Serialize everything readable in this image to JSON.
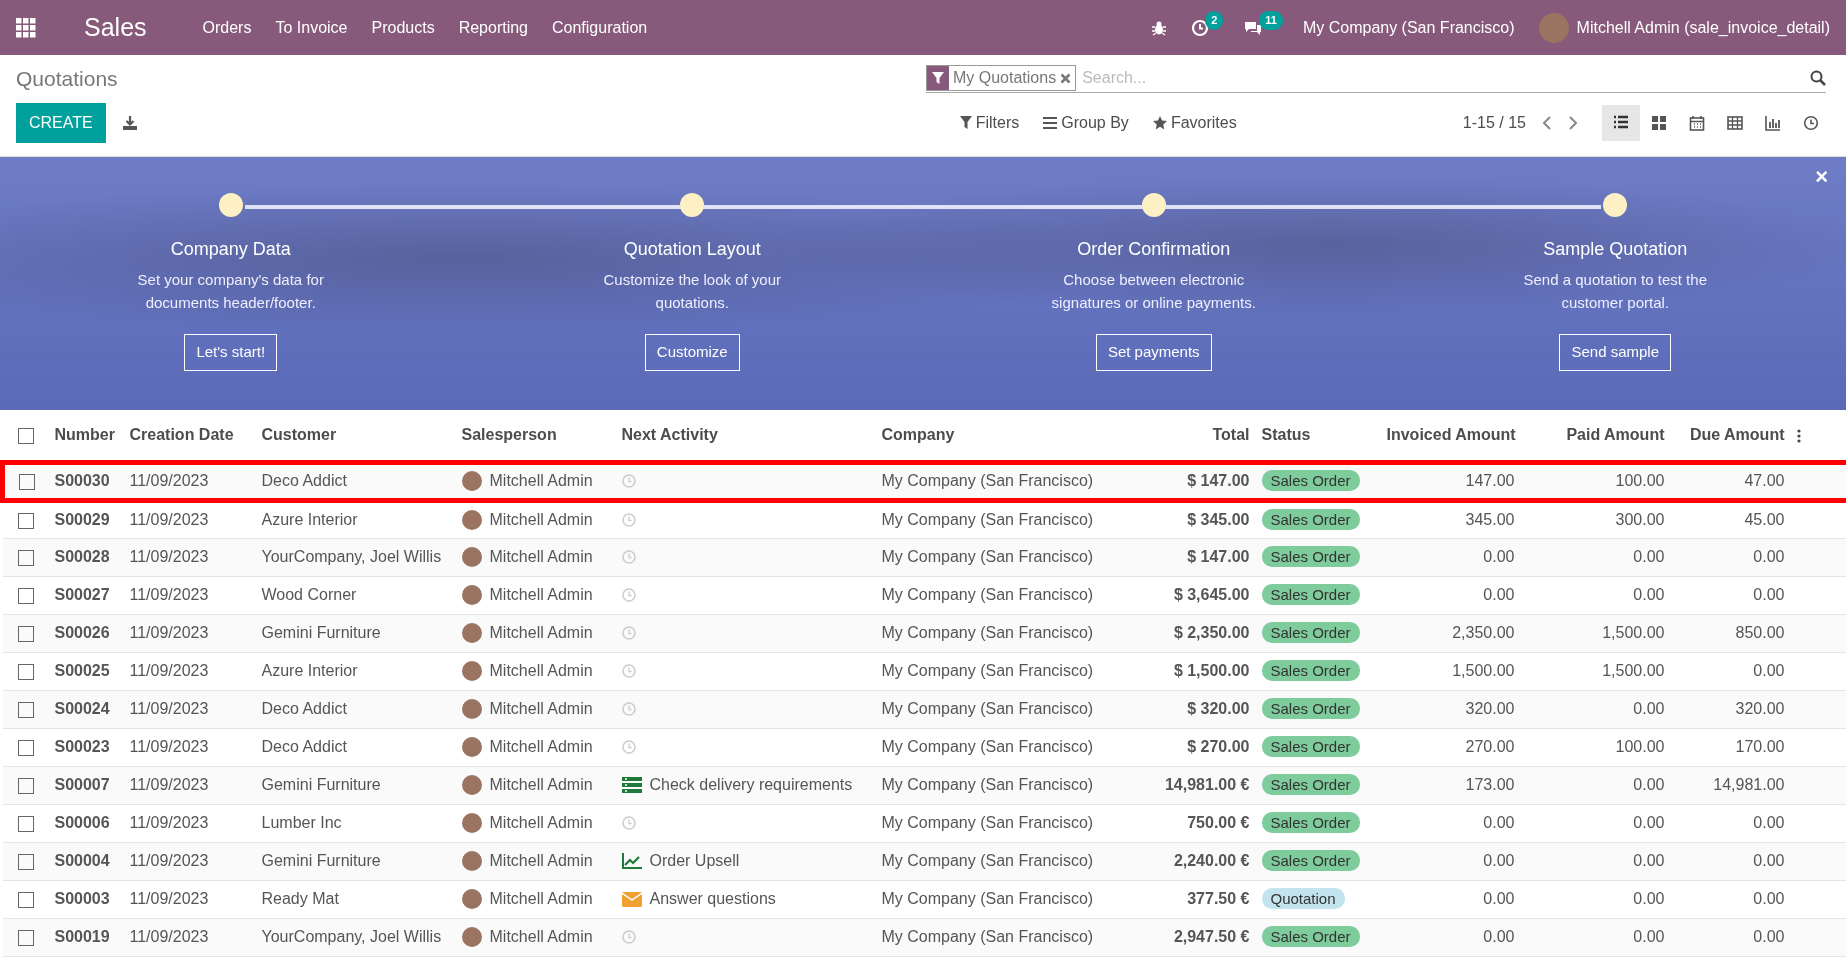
{
  "navbar": {
    "app_title": "Sales",
    "menu": [
      "Orders",
      "To Invoice",
      "Products",
      "Reporting",
      "Configuration"
    ],
    "activity_count": "2",
    "message_count": "11",
    "company": "My Company (San Francisco)",
    "user": "Mitchell Admin (sale_invoice_detail)"
  },
  "control_panel": {
    "breadcrumb": "Quotations",
    "create_label": "CREATE",
    "facet": "My Quotations",
    "search": {
      "placeholder": "Search..."
    },
    "filters": "Filters",
    "group_by": "Group By",
    "favorites": "Favorites",
    "pager": "1-15 / 15",
    "views": [
      {
        "kind": "list",
        "selected": true
      },
      {
        "kind": "kanban",
        "selected": false
      },
      {
        "kind": "calendar",
        "selected": false
      },
      {
        "kind": "pivot",
        "selected": false
      },
      {
        "kind": "graph",
        "selected": false
      },
      {
        "kind": "activity",
        "selected": false
      }
    ]
  },
  "onboarding": {
    "close": "×",
    "steps": [
      {
        "title": "Company Data",
        "text": "Set your company's data for documents header/footer.",
        "button": "Let's start!"
      },
      {
        "title": "Quotation Layout",
        "text": "Customize the look of your quotations.",
        "button": "Customize"
      },
      {
        "title": "Order Confirmation",
        "text": "Choose between electronic signatures or online payments.",
        "button": "Set payments"
      },
      {
        "title": "Sample Quotation",
        "text": "Send a quotation to test the customer portal.",
        "button": "Send sample"
      }
    ]
  },
  "table": {
    "select_all_checked": false,
    "columns": [
      "Number",
      "Creation Date",
      "Customer",
      "Salesperson",
      "Next Activity",
      "Company",
      "Total",
      "Status",
      "Invoiced Amount",
      "Paid Amount",
      "Due Amount"
    ],
    "rows": [
      {
        "highlighted": true,
        "checked": false,
        "number": "S00030",
        "date": "11/09/2023",
        "customer": "Deco Addict",
        "salesperson": "Mitchell Admin",
        "activity": {
          "kind": "none"
        },
        "company": "My Company (San Francisco)",
        "total": "$ 147.00",
        "status": {
          "kind": "sales_order",
          "label": "Sales Order"
        },
        "invoiced": "147.00",
        "paid": "100.00",
        "due": "47.00"
      },
      {
        "highlighted": false,
        "checked": false,
        "number": "S00029",
        "date": "11/09/2023",
        "customer": "Azure Interior",
        "salesperson": "Mitchell Admin",
        "activity": {
          "kind": "none"
        },
        "company": "My Company (San Francisco)",
        "total": "$ 345.00",
        "status": {
          "kind": "sales_order",
          "label": "Sales Order"
        },
        "invoiced": "345.00",
        "paid": "300.00",
        "due": "45.00"
      },
      {
        "highlighted": false,
        "checked": false,
        "number": "S00028",
        "date": "11/09/2023",
        "customer": "YourCompany, Joel Willis",
        "salesperson": "Mitchell Admin",
        "activity": {
          "kind": "none"
        },
        "company": "My Company (San Francisco)",
        "total": "$ 147.00",
        "status": {
          "kind": "sales_order",
          "label": "Sales Order"
        },
        "invoiced": "0.00",
        "paid": "0.00",
        "due": "0.00"
      },
      {
        "highlighted": false,
        "checked": false,
        "number": "S00027",
        "date": "11/09/2023",
        "customer": "Wood Corner",
        "salesperson": "Mitchell Admin",
        "activity": {
          "kind": "none"
        },
        "company": "My Company (San Francisco)",
        "total": "$ 3,645.00",
        "status": {
          "kind": "sales_order",
          "label": "Sales Order"
        },
        "invoiced": "0.00",
        "paid": "0.00",
        "due": "0.00"
      },
      {
        "highlighted": false,
        "checked": false,
        "number": "S00026",
        "date": "11/09/2023",
        "customer": "Gemini Furniture",
        "salesperson": "Mitchell Admin",
        "activity": {
          "kind": "none"
        },
        "company": "My Company (San Francisco)",
        "total": "$ 2,350.00",
        "status": {
          "kind": "sales_order",
          "label": "Sales Order"
        },
        "invoiced": "2,350.00",
        "paid": "1,500.00",
        "due": "850.00"
      },
      {
        "highlighted": false,
        "checked": false,
        "number": "S00025",
        "date": "11/09/2023",
        "customer": "Azure Interior",
        "salesperson": "Mitchell Admin",
        "activity": {
          "kind": "none"
        },
        "company": "My Company (San Francisco)",
        "total": "$ 1,500.00",
        "status": {
          "kind": "sales_order",
          "label": "Sales Order"
        },
        "invoiced": "1,500.00",
        "paid": "1,500.00",
        "due": "0.00"
      },
      {
        "highlighted": false,
        "checked": false,
        "number": "S00024",
        "date": "11/09/2023",
        "customer": "Deco Addict",
        "salesperson": "Mitchell Admin",
        "activity": {
          "kind": "none"
        },
        "company": "My Company (San Francisco)",
        "total": "$ 320.00",
        "status": {
          "kind": "sales_order",
          "label": "Sales Order"
        },
        "invoiced": "320.00",
        "paid": "0.00",
        "due": "320.00"
      },
      {
        "highlighted": false,
        "checked": false,
        "number": "S00023",
        "date": "11/09/2023",
        "customer": "Deco Addict",
        "salesperson": "Mitchell Admin",
        "activity": {
          "kind": "none"
        },
        "company": "My Company (San Francisco)",
        "total": "$ 270.00",
        "status": {
          "kind": "sales_order",
          "label": "Sales Order"
        },
        "invoiced": "270.00",
        "paid": "100.00",
        "due": "170.00"
      },
      {
        "highlighted": false,
        "checked": false,
        "number": "S00007",
        "date": "11/09/2023",
        "customer": "Gemini Furniture",
        "salesperson": "Mitchell Admin",
        "activity": {
          "kind": "todo",
          "label": "Check delivery requirements"
        },
        "company": "My Company (San Francisco)",
        "total": "14,981.00 €",
        "status": {
          "kind": "sales_order",
          "label": "Sales Order"
        },
        "invoiced": "173.00",
        "paid": "0.00",
        "due": "14,981.00"
      },
      {
        "highlighted": false,
        "checked": false,
        "number": "S00006",
        "date": "11/09/2023",
        "customer": "Lumber Inc",
        "salesperson": "Mitchell Admin",
        "activity": {
          "kind": "none"
        },
        "company": "My Company (San Francisco)",
        "total": "750.00 €",
        "status": {
          "kind": "sales_order",
          "label": "Sales Order"
        },
        "invoiced": "0.00",
        "paid": "0.00",
        "due": "0.00"
      },
      {
        "highlighted": false,
        "checked": false,
        "number": "S00004",
        "date": "11/09/2023",
        "customer": "Gemini Furniture",
        "salesperson": "Mitchell Admin",
        "activity": {
          "kind": "upsell",
          "label": "Order Upsell"
        },
        "company": "My Company (San Francisco)",
        "total": "2,240.00 €",
        "status": {
          "kind": "sales_order",
          "label": "Sales Order"
        },
        "invoiced": "0.00",
        "paid": "0.00",
        "due": "0.00"
      },
      {
        "highlighted": false,
        "checked": false,
        "number": "S00003",
        "date": "11/09/2023",
        "customer": "Ready Mat",
        "salesperson": "Mitchell Admin",
        "activity": {
          "kind": "email",
          "label": "Answer questions"
        },
        "company": "My Company (San Francisco)",
        "total": "377.50 €",
        "status": {
          "kind": "quotation",
          "label": "Quotation"
        },
        "invoiced": "0.00",
        "paid": "0.00",
        "due": "0.00"
      },
      {
        "highlighted": false,
        "checked": false,
        "number": "S00019",
        "date": "11/09/2023",
        "customer": "YourCompany, Joel Willis",
        "salesperson": "Mitchell Admin",
        "activity": {
          "kind": "none"
        },
        "company": "My Company (San Francisco)",
        "total": "2,947.50 €",
        "status": {
          "kind": "sales_order",
          "label": "Sales Order"
        },
        "invoiced": "0.00",
        "paid": "0.00",
        "due": "0.00"
      }
    ]
  }
}
